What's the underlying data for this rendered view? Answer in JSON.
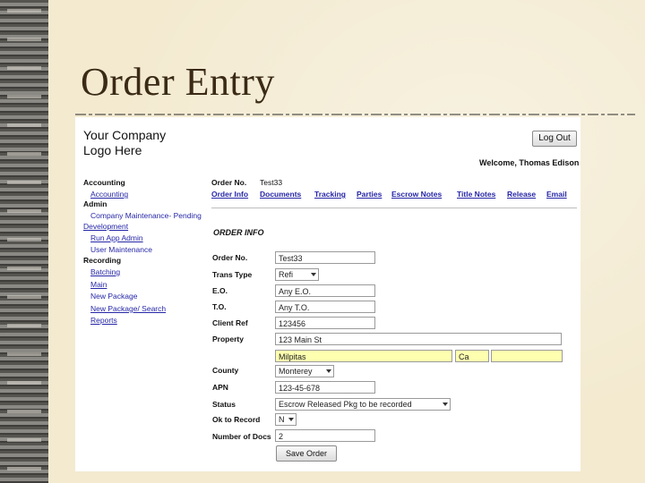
{
  "slide": {
    "title": "Order Entry"
  },
  "app": {
    "logo_line1": "Your Company",
    "logo_line2": "Logo Here",
    "logout_label": "Log Out",
    "welcome": "Welcome, Thomas Edison"
  },
  "nav": {
    "accounting": "Accounting",
    "accounting_link": "Accounting",
    "admin": "Admin",
    "company_maintenance": "Company Maintenance- Pending",
    "development": "Development",
    "run_app_admin": "Run App Admin",
    "user_maintenance": "User Maintenance",
    "recording": "Recording",
    "batching": "Batching",
    "main": "Main",
    "new_package": "New Package",
    "new_package_search": "New Package/ Search",
    "reports": "Reports"
  },
  "header": {
    "order_no_label": "Order No.",
    "order_no_value": "Test33"
  },
  "tabs": [
    {
      "label": "Order Info"
    },
    {
      "label": "Documents"
    },
    {
      "label": "Tracking"
    },
    {
      "label": "Parties"
    },
    {
      "label": "Escrow Notes"
    },
    {
      "label": "Title Notes"
    },
    {
      "label": "Release"
    },
    {
      "label": "Email"
    }
  ],
  "form": {
    "section_title": "ORDER INFO",
    "order_no": {
      "label": "Order No.",
      "value": "Test33"
    },
    "trans_type": {
      "label": "Trans Type",
      "value": "Refi"
    },
    "eo": {
      "label": "E.O.",
      "value": "Any E.O."
    },
    "to": {
      "label": "T.O.",
      "value": "Any T.O."
    },
    "client_ref": {
      "label": "Client Ref",
      "value": "123456"
    },
    "property": {
      "label": "Property",
      "street": "123 Main St",
      "city": "Milpitas",
      "state": "Ca",
      "zip": ""
    },
    "county": {
      "label": "County",
      "value": "Monterey"
    },
    "apn": {
      "label": "APN",
      "value": "123-45-678"
    },
    "status": {
      "label": "Status",
      "value": "Escrow Released Pkg to be recorded"
    },
    "ok_to_record": {
      "label": "Ok to Record",
      "value": "N"
    },
    "number_of_docs": {
      "label": "Number of Docs",
      "value": "2"
    },
    "save_label": "Save Order"
  },
  "colors": {
    "link": "#2626a8",
    "highlight": "#ffffb0",
    "title": "#3a2a16"
  }
}
